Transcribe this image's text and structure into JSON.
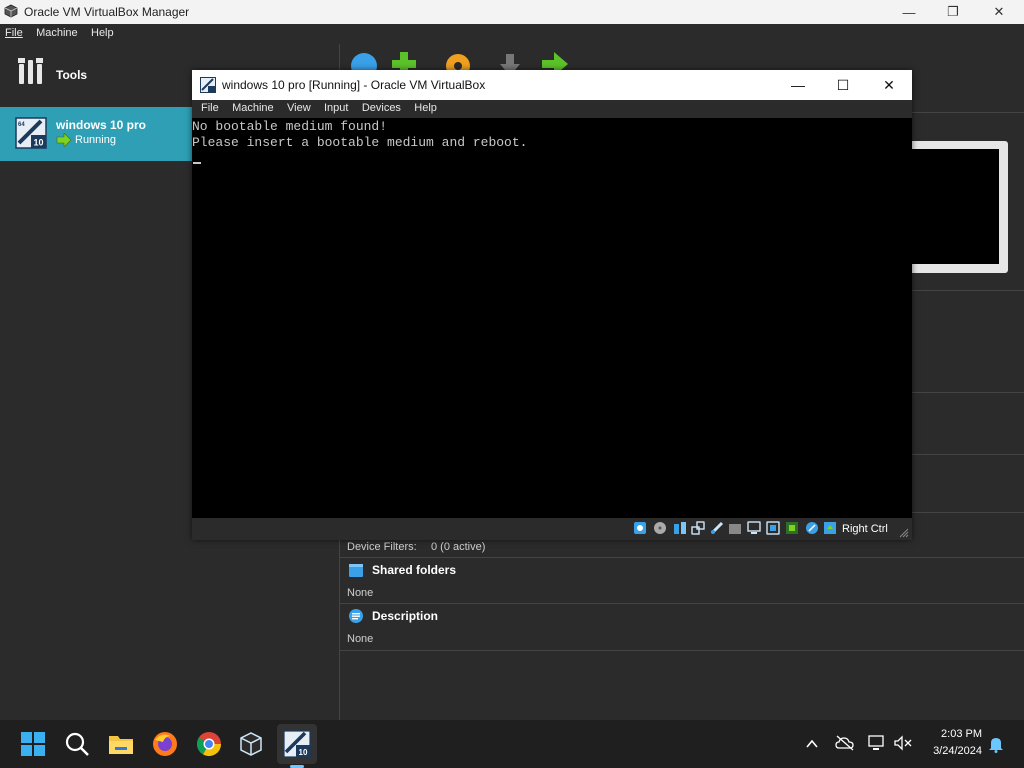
{
  "manager": {
    "title": "Oracle VM VirtualBox Manager",
    "menu": [
      "File",
      "Machine",
      "Help"
    ],
    "tools_label": "Tools",
    "vm": {
      "name": "windows 10 pro",
      "status": "Running"
    },
    "toolbar_icons": [
      "new-icon",
      "add-icon",
      "settings-icon",
      "discard-icon",
      "start-icon"
    ],
    "details": {
      "device_filters_label": "Device Filters:",
      "device_filters_value": "0 (0 active)",
      "shared_folders_header": "Shared folders",
      "shared_folders_value": "None",
      "description_header": "Description",
      "description_value": "None"
    }
  },
  "vm_window": {
    "title": "windows 10 pro [Running] - Oracle VM VirtualBox",
    "menu": [
      "File",
      "Machine",
      "View",
      "Input",
      "Devices",
      "Help"
    ],
    "screen_lines": [
      "No bootable medium found!",
      "Please insert a bootable medium and reboot."
    ],
    "host_key": "Right Ctrl"
  },
  "taskbar": {
    "time": "2:03 PM",
    "date": "3/24/2024"
  },
  "colors": {
    "selected_vm": "#2e9fb5",
    "accent": "#6cc6ff"
  }
}
